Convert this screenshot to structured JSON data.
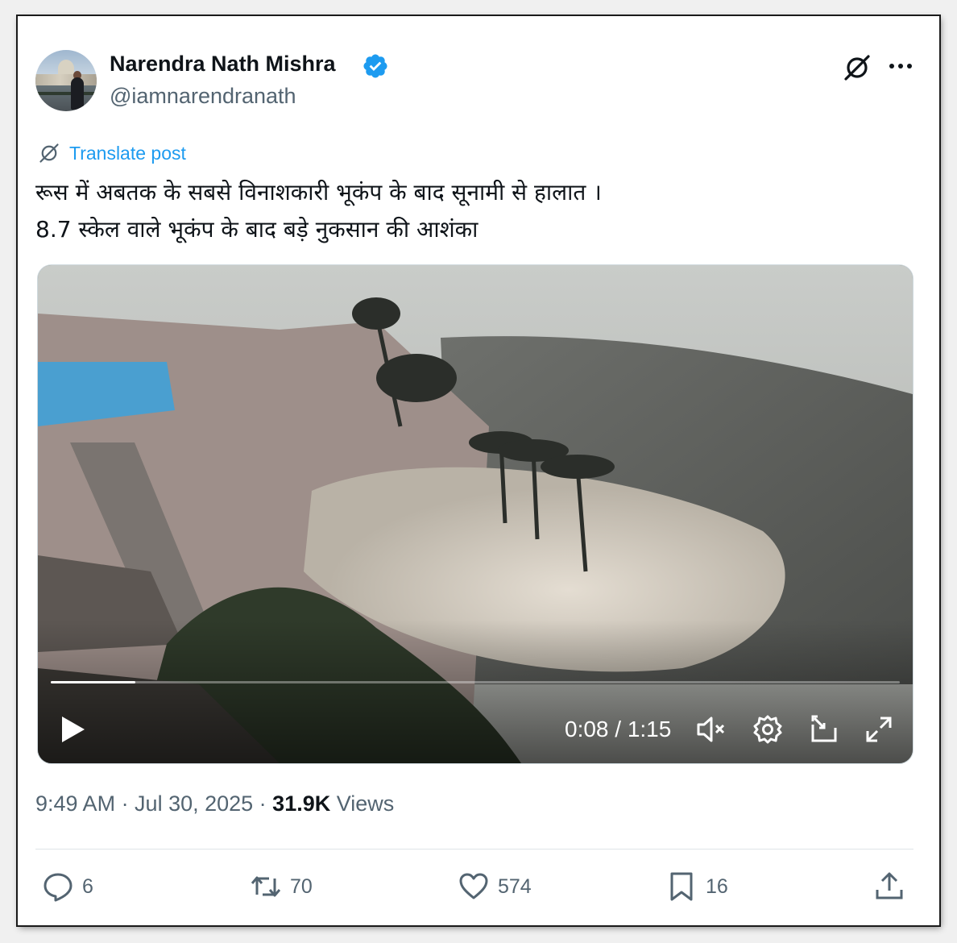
{
  "author": {
    "name": "Narendra Nath Mishra",
    "handle": "@iamnarendranath",
    "verified_color": "#1d9bf0"
  },
  "header_icons": [
    "grok-icon",
    "more-icon"
  ],
  "translate": {
    "label": "Translate post",
    "icon": "translate-icon"
  },
  "post": {
    "line1": "रूस में अबतक के सबसे विनाशकारी भूकंप के बाद सूनामी से हालात ।",
    "line2": "8.7 स्केल वाले भूकंप के बाद बड़े नुकसान की आशंका"
  },
  "video": {
    "time": "0:08 / 1:15",
    "progress": 0.1,
    "controls": [
      "play-icon",
      "mute-icon",
      "settings-icon",
      "pip-icon",
      "fullscreen-icon"
    ]
  },
  "meta": {
    "timestamp": "9:49 AM · Jul 30, 2025 · ",
    "views_count": "31.9K",
    "views_label": " Views"
  },
  "actions": {
    "replies": "6",
    "reposts": "70",
    "likes": "574",
    "bookmarks": "16"
  },
  "colors": {
    "text": "#0f1419",
    "secondary": "#536471",
    "accent": "#1d9bf0"
  }
}
